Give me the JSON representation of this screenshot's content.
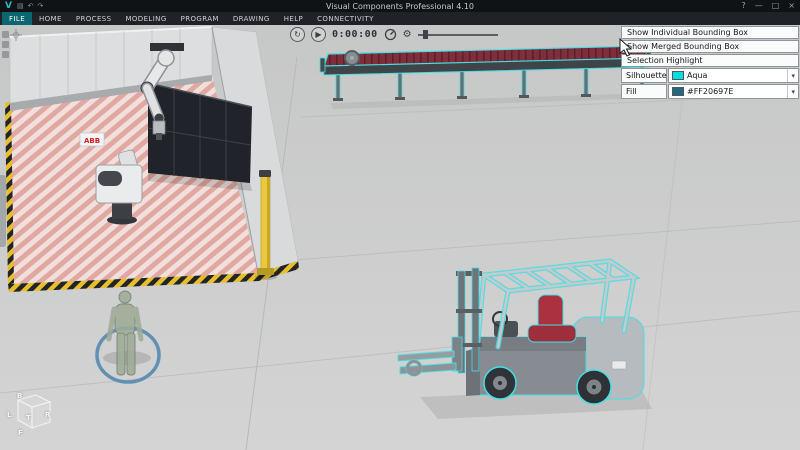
{
  "window": {
    "title": "Visual Components Professional 4.10"
  },
  "icons": {
    "logo": "V",
    "save": "▤",
    "undo": "↶",
    "redo": "↷",
    "help": "?",
    "minimize": "—",
    "maximize": "□",
    "close": "×",
    "reset": "↻",
    "play": "▶",
    "gear": "⚙",
    "dropdown_caret": "▾"
  },
  "menu": {
    "items": [
      "FILE",
      "HOME",
      "PROCESS",
      "MODELING",
      "PROGRAM",
      "DRAWING",
      "HELP",
      "CONNECTIVITY"
    ],
    "active": "FILE"
  },
  "playback": {
    "time": "0:00:00"
  },
  "selection_panel": {
    "show_individual_label": "Show Individual Bounding Box",
    "show_merged_label": "Show Merged Bounding Box",
    "selection_highlight_label": "Selection Highlight",
    "silhouette_label": "Silhouette",
    "silhouette_value": "Aqua",
    "silhouette_color": "#00DDE4",
    "fill_label": "Fill",
    "fill_value": "#FF20697E",
    "fill_color": "#20697E"
  },
  "view_cube": {
    "labels": [
      "B",
      "L",
      "T",
      "R",
      "F"
    ]
  },
  "scene": {
    "abb_logo": "ABB",
    "highlight_color": "#45DFE2",
    "selection_ring_color": "#5B8DB0"
  }
}
